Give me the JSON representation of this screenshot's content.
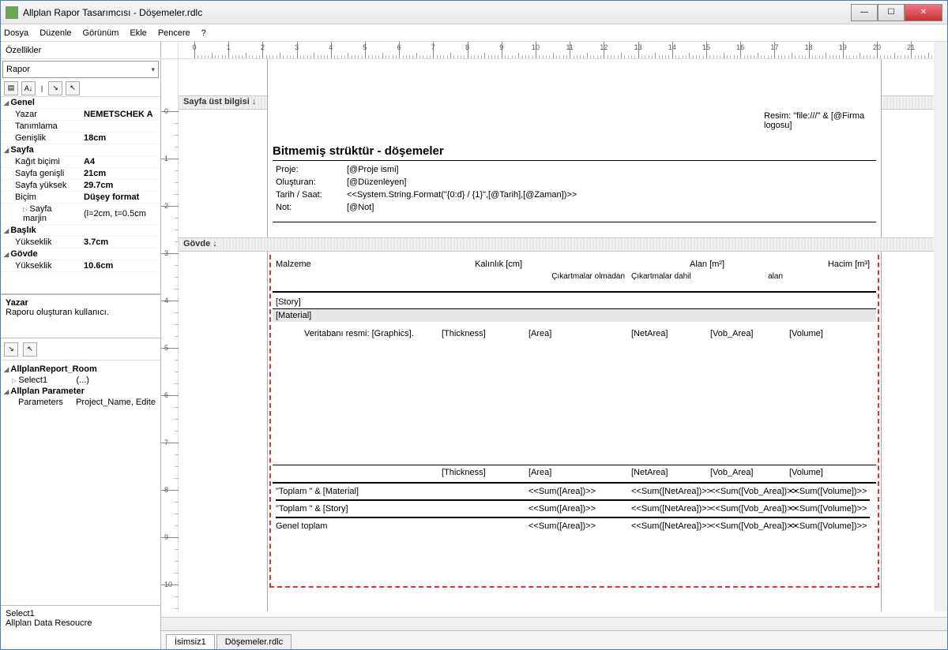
{
  "window": {
    "title": "Allplan Rapor Tasarımcısı - Döşemeler.rdlc"
  },
  "menu": {
    "dosya": "Dosya",
    "duzenle": "Düzenle",
    "gorunum": "Görünüm",
    "ekle": "Ekle",
    "pencere": "Pencere",
    "help": "?"
  },
  "panel": {
    "ozellikler": "Özellikler",
    "rapor": "Rapor"
  },
  "props": {
    "genel": "Genel",
    "yazar": "Yazar",
    "yazar_v": "NEMETSCHEK A",
    "tanimlama": "Tanımlama",
    "genislik": "Genişlik",
    "genislik_v": "18cm",
    "sayfa": "Sayfa",
    "kagit": "Kağıt biçimi",
    "kagit_v": "A4",
    "sayfa_g": "Sayfa genişli",
    "sayfa_g_v": "21cm",
    "sayfa_y": "Sayfa yüksek",
    "sayfa_y_v": "29.7cm",
    "bicim": "Biçim",
    "bicim_v": "Düşey format",
    "marjin": "Sayfa marjin",
    "marjin_v": "(l=2cm, t=0.5cm",
    "baslik": "Başlık",
    "yuk1": "Yükseklik",
    "yuk1_v": "3.7cm",
    "govde": "Gövde",
    "yuk2": "Yükseklik",
    "yuk2_v": "10.6cm"
  },
  "desc1": {
    "title": "Yazar",
    "body": "Raporu oluşturan kullanıcı."
  },
  "tree": {
    "n1": "AllplanReport_Room",
    "n1a": "Select1",
    "n1a_v": "(...)",
    "n2": "Allplan Parameter",
    "n2a": "Parameters",
    "n2a_v": "Project_Name, Edite"
  },
  "desc2": {
    "title": "Select1",
    "body": "Allplan Data Resoucre"
  },
  "band": {
    "header": "Sayfa üst bilgisi ↓",
    "body": "Gövde ↓"
  },
  "report": {
    "logo": "Resim: \"file:///\" & [@Firma logosu]",
    "title": "Bitmemiş strüktür - döşemeler",
    "proje_l": "Proje:",
    "proje_v": "[@Proje ismi]",
    "olust_l": "Oluşturan:",
    "olust_v": "[@Düzenleyen]",
    "tarih_l": "Tarih / Saat:",
    "tarih_v": "<<System.String.Format(\"{0:d}  /  {1}\",[@Tarih],[@Zaman])>>",
    "not_l": "Not:",
    "not_v": "[@Not]",
    "col_malzeme": "Malzeme",
    "col_kalinlik": "Kalınlık [cm]",
    "col_alan": "Alan [m²]",
    "col_hacim": "Hacim [m³]",
    "sub_olmadan": "Çıkartmalar olmadan",
    "sub_dahil": "Çıkartmalar dahil",
    "sub_alan": "alan",
    "story": "[Story]",
    "material": "[Material]",
    "veritabani": "Veritabanı resmi: [Graphics].",
    "thickness": "[Thickness]",
    "area": "[Area]",
    "netarea": "[NetArea]",
    "vobarea": "[Vob_Area]",
    "volume": "[Volume]",
    "toplam_mat": "\"Toplam \" & [Material]",
    "toplam_story": "\"Toplam \" & [Story]",
    "genel_toplam": "Genel toplam",
    "sum_area": "<<Sum([Area])>>",
    "sum_net": "<<Sum([NetArea])>>",
    "sum_vob": "<<Sum([Vob_Area])>>",
    "sum_vol": "<<Sum([Volume])>>"
  },
  "tabs": {
    "t1": "İsimsiz1",
    "t2": "Döşemeler.rdlc"
  }
}
